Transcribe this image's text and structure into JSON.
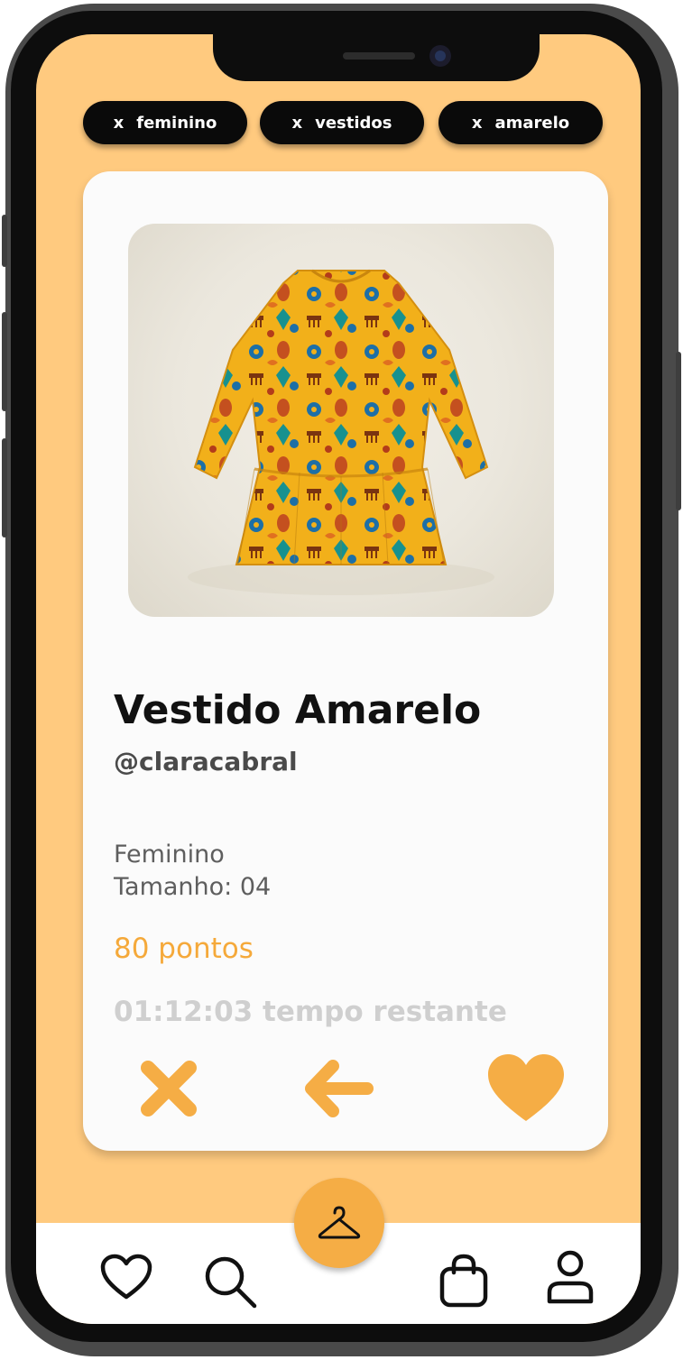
{
  "filters": [
    {
      "remove_glyph": "x",
      "label": "feminino"
    },
    {
      "remove_glyph": "x",
      "label": "vestidos"
    },
    {
      "remove_glyph": "x",
      "label": "amarelo"
    }
  ],
  "item": {
    "image_icon": "dress-photo",
    "title": "Vestido Amarelo",
    "owner": "@claracabral",
    "category": "Feminino",
    "size": "Tamanho: 04",
    "points": "80 pontos",
    "time_left": "01:12:03 tempo restante"
  },
  "actions": [
    {
      "icon": "close-icon"
    },
    {
      "icon": "arrow-left-icon"
    },
    {
      "icon": "heart-icon"
    }
  ],
  "bottom_nav": {
    "center_icon": "hanger-icon",
    "items": [
      {
        "icon": "heart-icon"
      },
      {
        "icon": "search-icon"
      },
      {
        "icon": "shopping-bag-icon"
      },
      {
        "icon": "user-icon"
      }
    ]
  },
  "colors": {
    "background": "#ffca7f",
    "accent": "#f5ad45",
    "chip": "#0a0a0a",
    "card": "#fbfbfb"
  }
}
